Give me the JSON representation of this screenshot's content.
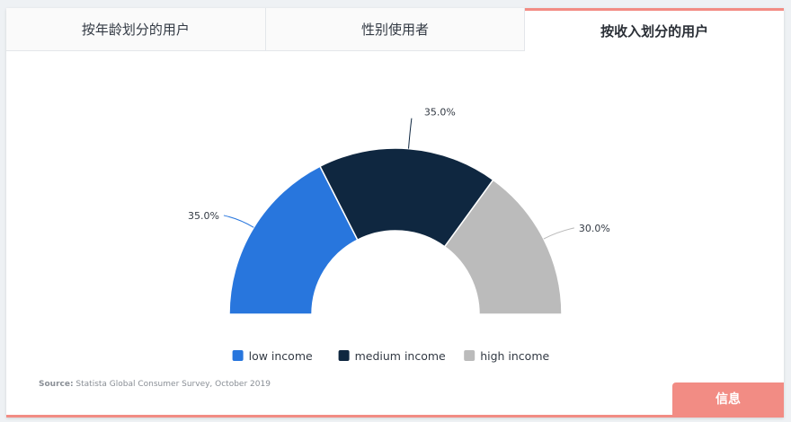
{
  "tabs": [
    {
      "label": "按年龄划分的用户",
      "active": false
    },
    {
      "label": "性别使用者",
      "active": false
    },
    {
      "label": "按收入划分的用户",
      "active": true
    }
  ],
  "chart_data": {
    "type": "pie",
    "variant": "semicircle-donut",
    "title": "",
    "categories": [
      "low income",
      "medium income",
      "high income"
    ],
    "values": [
      35.0,
      35.0,
      30.0
    ],
    "data_labels": [
      "35.0%",
      "35.0%",
      "30.0%"
    ],
    "colors": [
      "#2876dd",
      "#0f2740",
      "#bbbbbb"
    ],
    "legend": {
      "placement": "bottom-center",
      "entries": [
        "low income",
        "medium income",
        "high income"
      ]
    }
  },
  "source": {
    "prefix": "Source:",
    "text": " Statista Global Consumer Survey, October 2019"
  },
  "info_button": {
    "label": "信息"
  }
}
